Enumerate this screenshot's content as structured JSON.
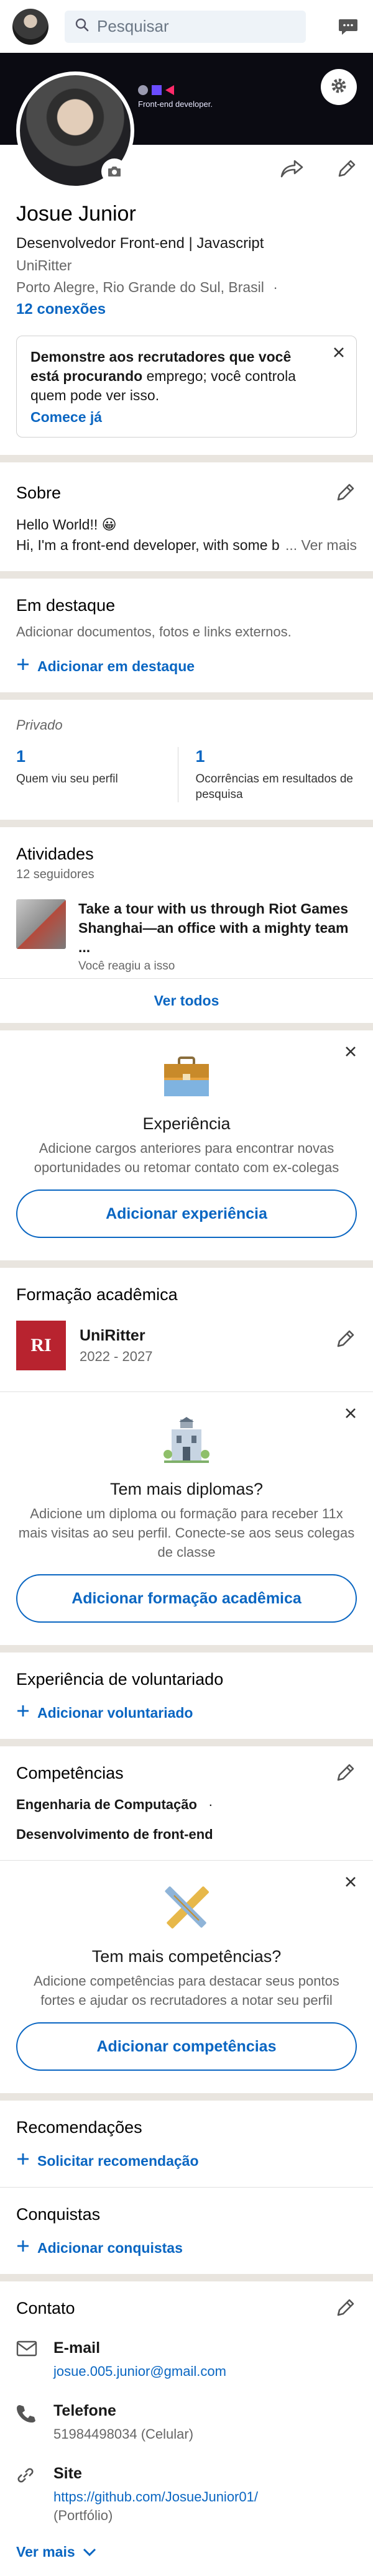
{
  "topbar": {
    "search_placeholder": "Pesquisar"
  },
  "banner": {
    "tagline": "Front-end developer."
  },
  "profile": {
    "name": "Josue Junior",
    "headline": "Desenvolvedor Front-end | Javascript",
    "school": "UniRitter",
    "location": "Porto Alegre, Rio Grande do Sul, Brasil",
    "location_sep": "·",
    "connections": "12 conexões"
  },
  "open_to_work": {
    "text_bold": "Demonstre aos recrutadores que você está procurando",
    "text_rest": "emprego; você controla quem pode ver isso.",
    "link": "Comece já"
  },
  "about": {
    "title": "Sobre",
    "line1": "Hello World!! 😀",
    "line2": "Hi, I'm a front-end developer, with some b",
    "see_more": "... Ver mais"
  },
  "featured": {
    "title": "Em destaque",
    "subtitle": "Adicionar documentos, fotos e links externos.",
    "add_link": "Adicionar em destaque"
  },
  "analytics": {
    "title": "Privado",
    "items": [
      {
        "value": "1",
        "label": "Quem viu seu perfil"
      },
      {
        "value": "1",
        "label": "Ocorrências em resultados de pesquisa"
      }
    ]
  },
  "activity": {
    "title": "Atividades",
    "followers": "12 seguidores",
    "post_title": "Take a tour with us through Riot Games Shanghai—an office with a mighty team ...",
    "post_meta": "Você reagiu a isso",
    "see_all": "Ver todos"
  },
  "experience_card": {
    "title": "Experiência",
    "desc": "Adicione cargos anteriores para encontrar novas oportunidades ou retomar contato com ex-colegas",
    "button": "Adicionar experiência"
  },
  "education": {
    "title": "Formação acadêmica",
    "logo_text": "RI",
    "name": "UniRitter",
    "years": "2022 - 2027"
  },
  "diplomas_card": {
    "title": "Tem mais diplomas?",
    "desc": "Adicione um diploma ou formação para receber 11x mais visitas ao seu perfil. Conecte-se aos seus colegas de classe",
    "button": "Adicionar formação acadêmica"
  },
  "volunteer": {
    "title": "Experiência de voluntariado",
    "add_link": "Adicionar voluntariado"
  },
  "skills": {
    "title": "Competências",
    "items": [
      "Engenharia de Computação",
      "Desenvolvimento de front-end"
    ],
    "item_sep": "·"
  },
  "skills_card": {
    "title": "Tem mais competências?",
    "desc": "Adicione competências para destacar seus pontos fortes e ajudar os recrutadores a notar seu perfil",
    "button": "Adicionar competências"
  },
  "recommendations": {
    "title": "Recomendações",
    "add_link": "Solicitar recomendação"
  },
  "accomplishments": {
    "title": "Conquistas",
    "add_link": "Adicionar conquistas"
  },
  "contact": {
    "title": "Contato",
    "email_label": "E-mail",
    "email_value": "josue.005.junior@gmail.com",
    "phone_label": "Telefone",
    "phone_value": "51984498034 (Celular)",
    "site_label": "Site",
    "site_value": "https://github.com/JosueJunior01/",
    "site_note": "(Portfólio)",
    "see_more": "Ver mais"
  },
  "colors": {
    "accent": "#0a66c2",
    "separator": "#e9e5df",
    "banner": "#0b0b12"
  }
}
